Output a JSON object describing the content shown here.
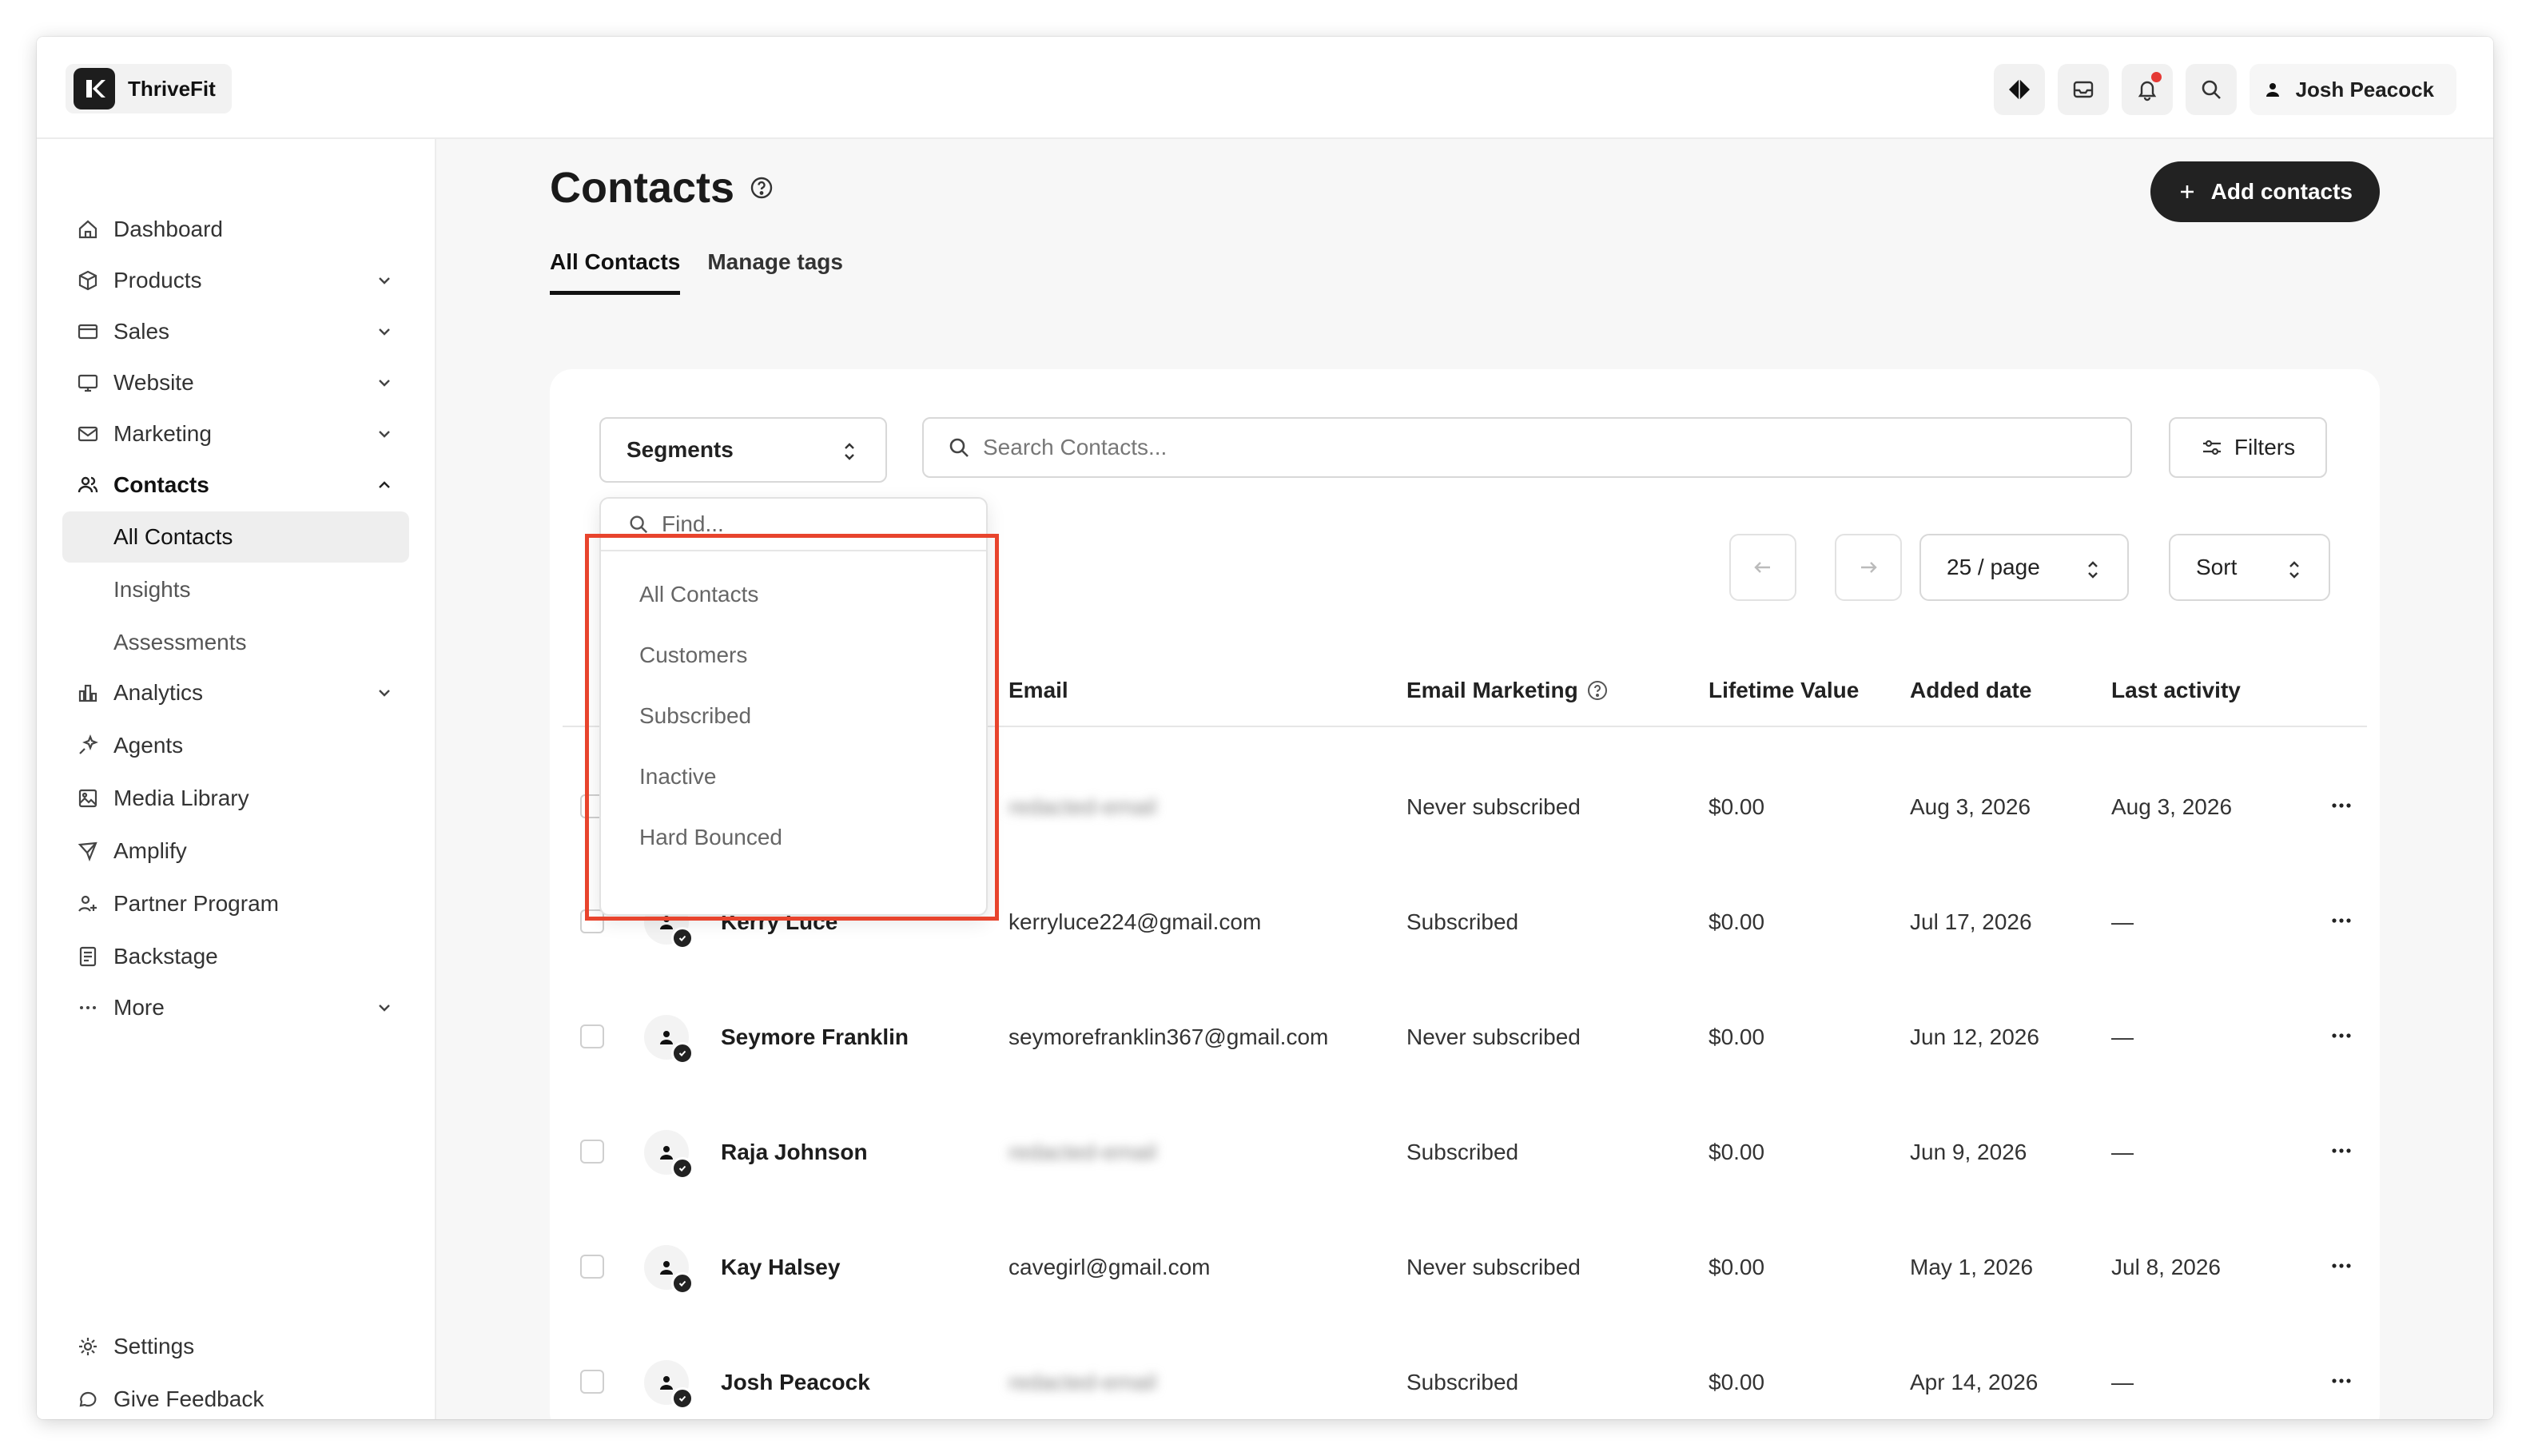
{
  "app": {
    "name": "ThriveFit"
  },
  "header": {
    "user_name": "Josh Peacock"
  },
  "sidebar": {
    "items": [
      {
        "label": "Dashboard"
      },
      {
        "label": "Products"
      },
      {
        "label": "Sales"
      },
      {
        "label": "Website"
      },
      {
        "label": "Marketing"
      },
      {
        "label": "Contacts"
      },
      {
        "label": "All Contacts"
      },
      {
        "label": "Insights"
      },
      {
        "label": "Assessments"
      },
      {
        "label": "Analytics"
      },
      {
        "label": "Agents"
      },
      {
        "label": "Media Library"
      },
      {
        "label": "Amplify"
      },
      {
        "label": "Partner Program"
      },
      {
        "label": "Backstage"
      },
      {
        "label": "More"
      }
    ],
    "footer": [
      {
        "label": "Settings"
      },
      {
        "label": "Give Feedback"
      }
    ]
  },
  "page": {
    "title": "Contacts",
    "add_button": "Add contacts",
    "tabs": [
      {
        "label": "All Contacts"
      },
      {
        "label": "Manage tags"
      }
    ]
  },
  "toolbar": {
    "segments_label": "Segments",
    "search_placeholder": "Search Contacts...",
    "filters_label": "Filters",
    "per_page": "25 / page",
    "sort_label": "Sort"
  },
  "segments_dropdown": {
    "find_placeholder": "Find...",
    "options": [
      "All Contacts",
      "Customers",
      "Subscribed",
      "Inactive",
      "Hard Bounced"
    ]
  },
  "table": {
    "columns": [
      "Email",
      "Email Marketing",
      "Lifetime Value",
      "Added date",
      "Last activity"
    ],
    "rows": [
      {
        "name": "",
        "email": "redacted-email",
        "email_blurred": true,
        "marketing": "Never subscribed",
        "ltv": "$0.00",
        "added": "Aug 3, 2026",
        "last": "Aug 3, 2026"
      },
      {
        "name": "Kerry Luce",
        "email": "kerryluce224@gmail.com",
        "email_blurred": false,
        "marketing": "Subscribed",
        "ltv": "$0.00",
        "added": "Jul 17, 2026",
        "last": "—"
      },
      {
        "name": "Seymore Franklin",
        "email": "seymorefranklin367@gmail.com",
        "email_blurred": false,
        "marketing": "Never subscribed",
        "ltv": "$0.00",
        "added": "Jun 12, 2026",
        "last": "—"
      },
      {
        "name": "Raja Johnson",
        "email": "redacted-email",
        "email_blurred": true,
        "marketing": "Subscribed",
        "ltv": "$0.00",
        "added": "Jun 9, 2026",
        "last": "—"
      },
      {
        "name": "Kay Halsey",
        "email": "cavegirl@gmail.com",
        "email_blurred": false,
        "marketing": "Never subscribed",
        "ltv": "$0.00",
        "added": "May 1, 2026",
        "last": "Jul 8, 2026"
      },
      {
        "name": "Josh Peacock",
        "email": "redacted-email",
        "email_blurred": true,
        "marketing": "Subscribed",
        "ltv": "$0.00",
        "added": "Apr 14, 2026",
        "last": "—"
      }
    ]
  },
  "colors": {
    "accent_dark": "#222222",
    "highlight": "#e8442d",
    "notification": "#e53935"
  }
}
